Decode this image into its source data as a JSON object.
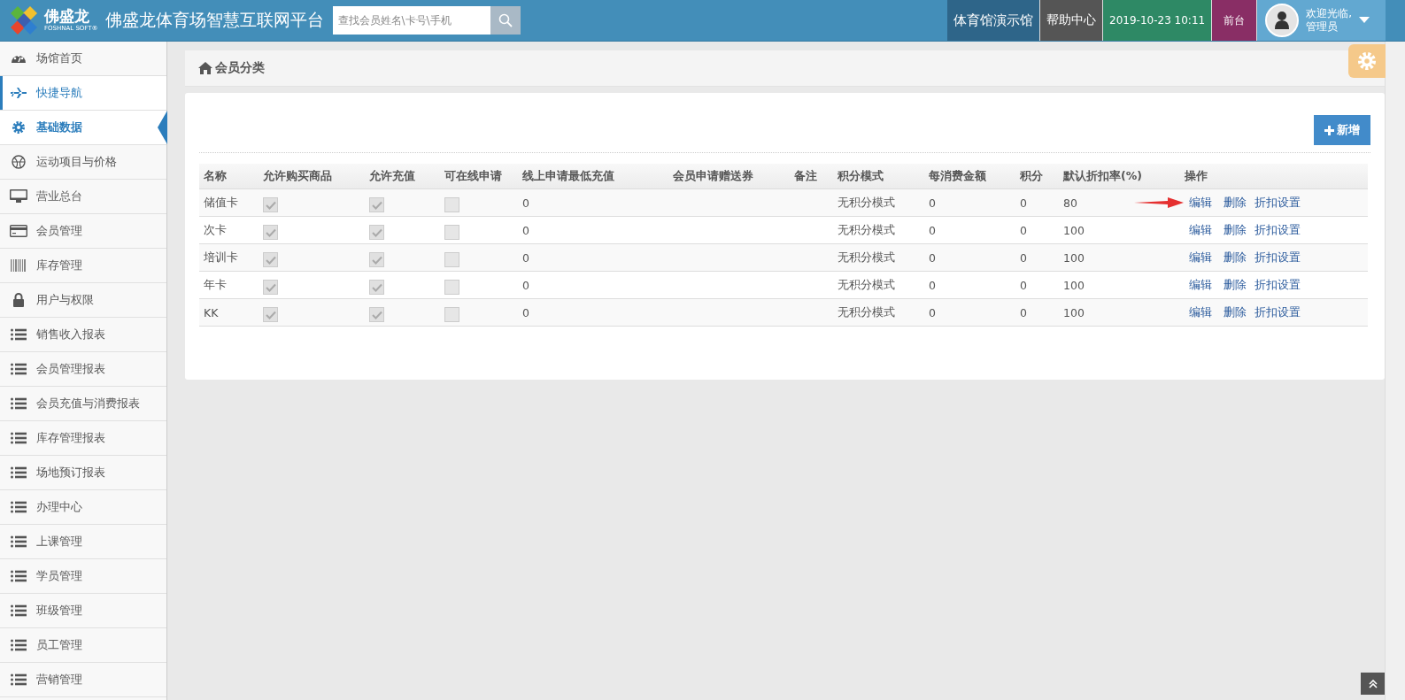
{
  "header": {
    "logo_text": "佛盛龙",
    "logo_subtext": "FOSHNAL SOFT®",
    "title": "佛盛龙体育场智慧互联网平台",
    "search": {
      "placeholder": "查找会员姓名\\卡号\\手机"
    },
    "venue": "体育馆演示馆",
    "help": "帮助中心",
    "datetime": "2019-10-23 10:11",
    "front_desk": "前台",
    "user": {
      "greeting": "欢迎光临,",
      "name": "管理员"
    }
  },
  "sidebar": {
    "items": [
      {
        "label": "场馆首页",
        "kind": "gauge",
        "selected": false,
        "marked": false
      },
      {
        "label": "快捷导航",
        "kind": "plane",
        "selected": false,
        "marked": true
      },
      {
        "label": "基础数据",
        "kind": "gear",
        "selected": true,
        "marked": false
      },
      {
        "label": "运动项目与价格",
        "kind": "ball",
        "selected": false,
        "marked": false
      },
      {
        "label": "营业总台",
        "kind": "monitor",
        "selected": false,
        "marked": false
      },
      {
        "label": "会员管理",
        "kind": "card",
        "selected": false,
        "marked": false
      },
      {
        "label": "库存管理",
        "kind": "barcode",
        "selected": false,
        "marked": false
      },
      {
        "label": "用户与权限",
        "kind": "lock",
        "selected": false,
        "marked": false
      },
      {
        "label": "销售收入报表",
        "kind": "list",
        "selected": false,
        "marked": false
      },
      {
        "label": "会员管理报表",
        "kind": "list",
        "selected": false,
        "marked": false
      },
      {
        "label": "会员充值与消费报表",
        "kind": "list",
        "selected": false,
        "marked": false
      },
      {
        "label": "库存管理报表",
        "kind": "list",
        "selected": false,
        "marked": false
      },
      {
        "label": "场地预订报表",
        "kind": "list",
        "selected": false,
        "marked": false
      },
      {
        "label": "办理中心",
        "kind": "list",
        "selected": false,
        "marked": false
      },
      {
        "label": "上课管理",
        "kind": "list",
        "selected": false,
        "marked": false
      },
      {
        "label": "学员管理",
        "kind": "list",
        "selected": false,
        "marked": false
      },
      {
        "label": "班级管理",
        "kind": "list",
        "selected": false,
        "marked": false
      },
      {
        "label": "员工管理",
        "kind": "list",
        "selected": false,
        "marked": false
      },
      {
        "label": "营销管理",
        "kind": "list",
        "selected": false,
        "marked": false
      }
    ]
  },
  "breadcrumb": "会员分类",
  "add_button": "新增",
  "table": {
    "columns": [
      "名称",
      "允许购买商品",
      "允许充值",
      "可在线申请",
      "线上申请最低充值",
      "会员申请赠送券",
      "备注",
      "积分模式",
      "每消费金额",
      "积分",
      "默认折扣率(%)",
      "操作"
    ],
    "rows": [
      {
        "name": "储值卡",
        "allow_buy": true,
        "allow_recharge": true,
        "online_apply": false,
        "min_recharge": "0",
        "points_mode": "无积分模式",
        "per_amount": "0",
        "points": "0",
        "discount": "80",
        "actions": [
          "编辑",
          "删除",
          "折扣设置"
        ],
        "arrow": true
      },
      {
        "name": "次卡",
        "allow_buy": true,
        "allow_recharge": true,
        "online_apply": false,
        "min_recharge": "0",
        "points_mode": "无积分模式",
        "per_amount": "0",
        "points": "0",
        "discount": "100",
        "actions": [
          "编辑",
          "删除",
          "折扣设置"
        ],
        "arrow": false
      },
      {
        "name": "培训卡",
        "allow_buy": true,
        "allow_recharge": true,
        "online_apply": false,
        "min_recharge": "0",
        "points_mode": "无积分模式",
        "per_amount": "0",
        "points": "0",
        "discount": "100",
        "actions": [
          "编辑",
          "删除",
          "折扣设置"
        ],
        "arrow": false
      },
      {
        "name": "年卡",
        "allow_buy": true,
        "allow_recharge": true,
        "online_apply": false,
        "min_recharge": "0",
        "points_mode": "无积分模式",
        "per_amount": "0",
        "points": "0",
        "discount": "100",
        "actions": [
          "编辑",
          "删除",
          "折扣设置"
        ],
        "arrow": false
      },
      {
        "name": "KK",
        "allow_buy": true,
        "allow_recharge": true,
        "online_apply": false,
        "min_recharge": "0",
        "points_mode": "无积分模式",
        "per_amount": "0",
        "points": "0",
        "discount": "100",
        "actions": [
          "编辑",
          "删除",
          "折扣设置"
        ],
        "arrow": false
      }
    ]
  }
}
